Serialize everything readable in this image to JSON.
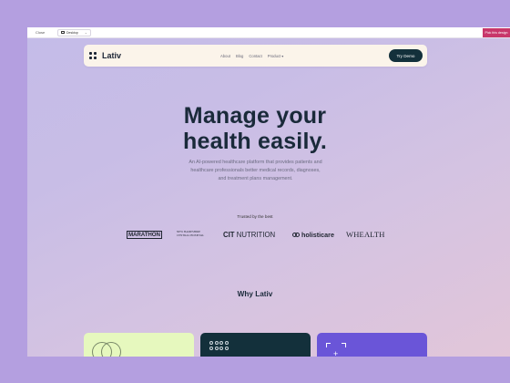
{
  "editor": {
    "close_label": "Close",
    "device_label": "Desktop",
    "cta_label": "Pick this design"
  },
  "nav": {
    "brand": "Lativ",
    "links": [
      "About",
      "Blog",
      "Contact"
    ],
    "product_label": "Product",
    "demo_button": "Try Demo"
  },
  "hero": {
    "title_line1": "Manage your",
    "title_line2": "health easily.",
    "subtitle_line1": "An AI-powered healthcare platform that provides patients and",
    "subtitle_line2": "healthcare professionals better medical records, diagnoses,",
    "subtitle_line3": "and treatment plans management."
  },
  "trusted": {
    "label": "Trusted by the best",
    "logos": {
      "marathon": "MARATHON",
      "nhch_line1": "NEW HAMPSHIRE",
      "nhch_line2": "CENTRAL HOSPITAL",
      "cit_bold": "CIT",
      "cit_rest": "NUTRITION",
      "holisticare": "holisticare",
      "whealth": "WHEALTH"
    }
  },
  "why": {
    "title": "Why Lativ"
  },
  "colors": {
    "outer_bg": "#b49fe0",
    "cta_pink": "#c8366a",
    "dark_teal": "#13303b",
    "lime_card": "#e6f8be",
    "purple_card": "#6a55d8",
    "nav_bg": "#fbf4ea"
  }
}
